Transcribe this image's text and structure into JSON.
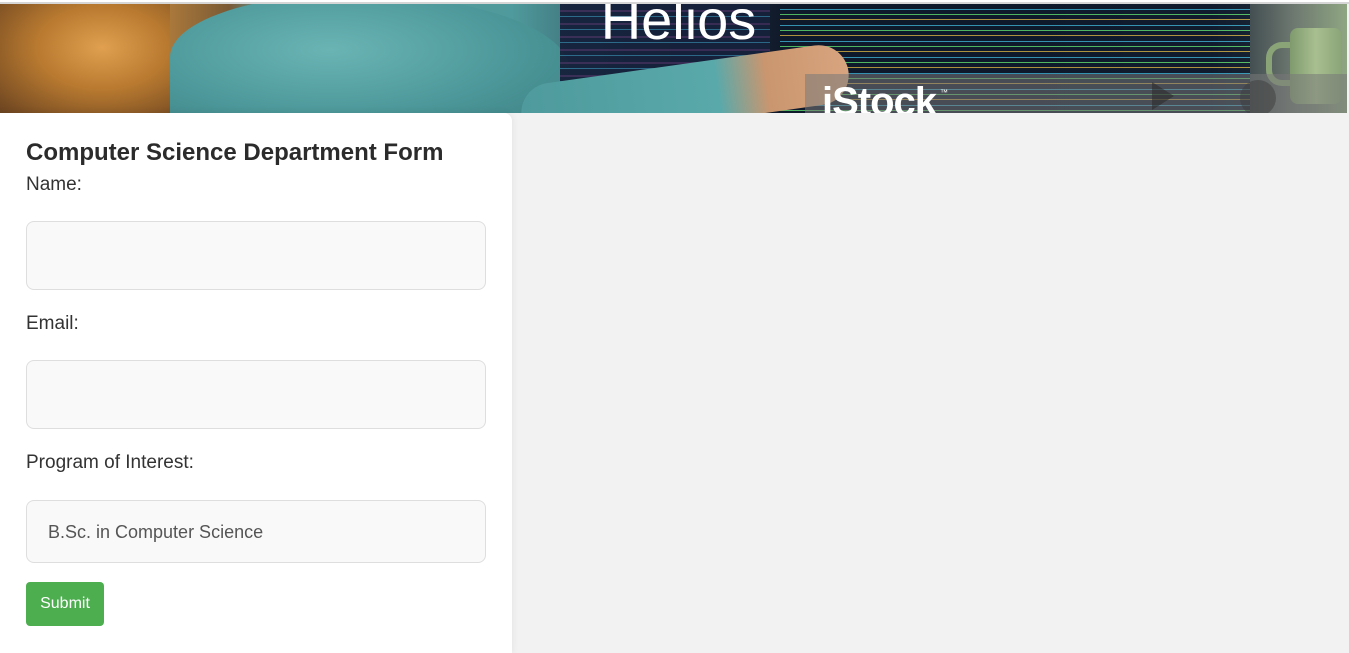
{
  "banner": {
    "title": "Helios",
    "watermark": "iStock",
    "watermark_tm": "™"
  },
  "form": {
    "title": "Computer Science Department Form",
    "name_label": "Name:",
    "name_value": "",
    "email_label": "Email:",
    "email_value": "",
    "program_label": "Program of Interest:",
    "program_selected": "B.Sc. in Computer Science",
    "submit_label": "Submit"
  },
  "colors": {
    "submit_bg": "#4cae4f",
    "page_bg": "#f2f2f2",
    "card_bg": "#ffffff"
  }
}
